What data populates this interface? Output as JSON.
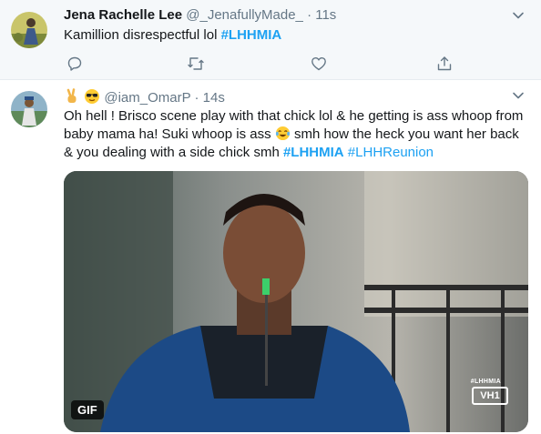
{
  "tweets": [
    {
      "name": "Jena Rachelle Lee",
      "handle": "@_JenafullyMade_",
      "separator": "·",
      "time": "11s",
      "text": "Kamillion disrespectful lol ",
      "hashtag": "#LHHMIA",
      "actions": [
        "reply-icon",
        "retweet-icon",
        "like-icon",
        "share-icon"
      ]
    },
    {
      "name_emojis": [
        "victory-hand-emoji",
        "sunglasses-emoji"
      ],
      "handle": "@iam_OmarP",
      "separator": "·",
      "time": "14s",
      "text_part1": "Oh hell ! Brisco scene play with that chick lol & he getting is ass whoop from baby mama ha! Suki whoop is ass ",
      "text_part2": " smh how the heck you want her back & you dealing with a side chick smh ",
      "hashtag1": "#LHHMIA",
      "hashtag2": "#LHHReunion",
      "media": {
        "badge": "GIF",
        "watermark_tag": "#LHHMIA",
        "watermark_logo": "VH1"
      }
    }
  ],
  "colors": {
    "link": "#1da1f2",
    "secondary_text": "#657786",
    "highlight_bg": "#f5f8fa",
    "border": "#e6ecf0"
  }
}
